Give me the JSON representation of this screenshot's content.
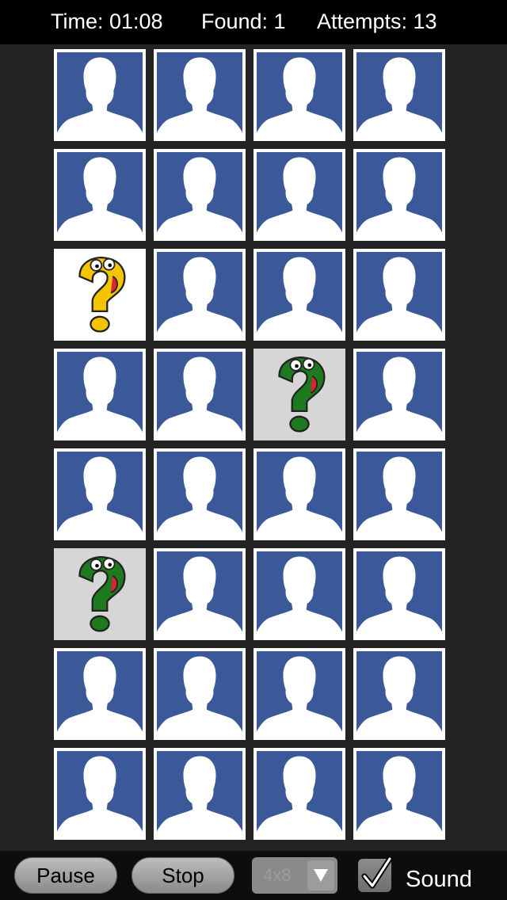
{
  "header": {
    "time_text": "Time: 01:08",
    "found_text": "Found: 1",
    "attempts_text": "Attempts: 13"
  },
  "board": {
    "columns": 4,
    "rows": 8,
    "cards": [
      "back",
      "back",
      "back",
      "back",
      "back",
      "back",
      "back",
      "back",
      "revealed-yellow",
      "back",
      "back",
      "back",
      "back",
      "back",
      "matched-green",
      "back",
      "back",
      "back",
      "back",
      "back",
      "matched-green",
      "back",
      "back",
      "back",
      "back",
      "back",
      "back",
      "back",
      "back",
      "back",
      "back",
      "back"
    ]
  },
  "controls": {
    "pause_label": "Pause",
    "stop_label": "Stop",
    "grid_size_value": "4x8",
    "sound_label": "Sound",
    "sound_checked": true
  },
  "colors": {
    "card_back": "#3b5998",
    "yellow_mascot": "#f5c400",
    "green_mascot": "#1e7a1e"
  },
  "icons": {
    "card_back": "person-silhouette-icon",
    "revealed": "question-mark-mascot-icon",
    "dropdown": "chevron-down-icon",
    "check": "checkmark-icon"
  }
}
